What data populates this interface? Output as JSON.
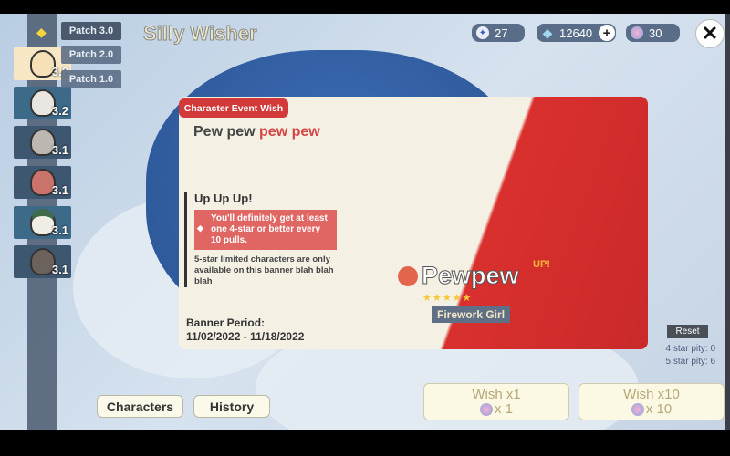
{
  "app": {
    "title": "Silly Wisher"
  },
  "sidebar": {
    "patches": [
      {
        "label": "Patch 3.0",
        "selected": true
      },
      {
        "label": "Patch 2.0"
      },
      {
        "label": "Patch 1.0"
      }
    ],
    "banners": [
      {
        "version": "3.2",
        "selected": true
      },
      {
        "version": "3.2"
      },
      {
        "version": "3.1"
      },
      {
        "version": "3.1"
      },
      {
        "version": "3.1"
      },
      {
        "version": "3.1"
      }
    ]
  },
  "currency": [
    {
      "icon": "starglitter-icon",
      "value": "27"
    },
    {
      "icon": "primogem-icon",
      "value": "12640"
    },
    {
      "icon": "fate-icon",
      "value": "30"
    }
  ],
  "banner": {
    "tab": "Character Event Wish",
    "title_a": "Pew pew",
    "title_b": "pew pew",
    "heading": "Up Up Up!",
    "guarantee": "You'll definitely get at least one 4-star or better every 10 pulls.",
    "description": "5-star limited characters are only available on this banner blah blah blah",
    "period_label": "Banner Period:",
    "period": "11/02/2022 - 11/18/2022",
    "character": "Pewpew",
    "up": "UP!",
    "stars": "★★★★★",
    "subtitle": "Firework Girl"
  },
  "pity": {
    "reset": "Reset",
    "four": "4 star pity: 0",
    "five": "5 star pity: 6"
  },
  "buttons": {
    "characters": "Characters",
    "history": "History",
    "wish1": "Wish x1",
    "wish1_cost": "x 1",
    "wish10": "Wish x10",
    "wish10_cost": "x 10"
  },
  "colors": {
    "accent": "#d23a3a",
    "panel": "#f4f1e4",
    "art": "#c92a29"
  }
}
